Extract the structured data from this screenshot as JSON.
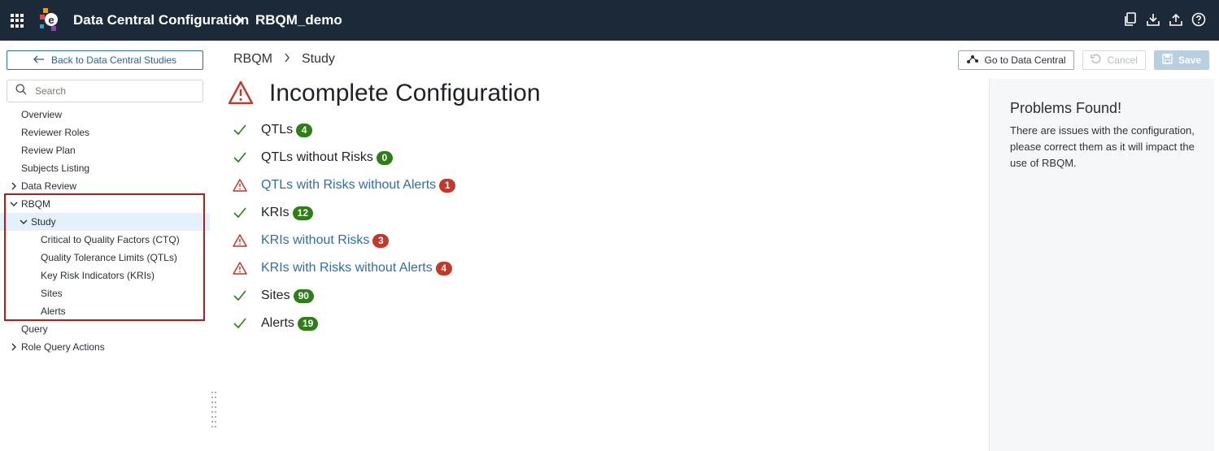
{
  "header": {
    "app_title": "Data Central Configuration",
    "project": "RBQM_demo",
    "colors": {
      "bar": "#1c2939"
    },
    "actions": [
      {
        "icon": "copy-icon"
      },
      {
        "icon": "download-icon"
      },
      {
        "icon": "upload-icon"
      },
      {
        "icon": "help-icon"
      }
    ]
  },
  "sidebar": {
    "back_label": "Back to Data Central Studies",
    "search_placeholder": "Search",
    "items": [
      {
        "label": "Overview",
        "level": 0
      },
      {
        "label": "Reviewer Roles",
        "level": 0
      },
      {
        "label": "Review Plan",
        "level": 0
      },
      {
        "label": "Subjects Listing",
        "level": 0
      },
      {
        "label": "Data Review",
        "level": 0,
        "expandable": true,
        "expanded": false
      },
      {
        "label": "RBQM",
        "level": 0,
        "expandable": true,
        "expanded": true
      },
      {
        "label": "Study",
        "level": 1,
        "expandable": true,
        "expanded": true,
        "selected": true
      },
      {
        "label": "Critical to Quality Factors (CTQ)",
        "level": 2
      },
      {
        "label": "Quality Tolerance Limits (QTLs)",
        "level": 2
      },
      {
        "label": "Key Risk Indicators (KRIs)",
        "level": 2
      },
      {
        "label": "Sites",
        "level": 2
      },
      {
        "label": "Alerts",
        "level": 2
      },
      {
        "label": "Query",
        "level": 0
      },
      {
        "label": "Role Query Actions",
        "level": 0,
        "expandable": true,
        "expanded": false
      }
    ]
  },
  "main": {
    "breadcrumb": [
      "RBQM",
      "Study"
    ],
    "buttons": {
      "go_to": "Go to Data Central",
      "cancel": "Cancel",
      "save": "Save"
    },
    "title": "Incomplete Configuration",
    "checks": [
      {
        "label": "QTLs",
        "count": "4",
        "status": "ok"
      },
      {
        "label": "QTLs without Risks",
        "count": "0",
        "status": "ok"
      },
      {
        "label": "QTLs with Risks without Alerts",
        "count": "1",
        "status": "warning"
      },
      {
        "label": "KRIs",
        "count": "12",
        "status": "ok"
      },
      {
        "label": "KRIs without Risks",
        "count": "3",
        "status": "warning"
      },
      {
        "label": "KRIs with Risks without Alerts",
        "count": "4",
        "status": "warning"
      },
      {
        "label": "Sites",
        "count": "90",
        "status": "ok"
      },
      {
        "label": "Alerts",
        "count": "19",
        "status": "ok"
      }
    ],
    "status_colors": {
      "ok": "#2e7d18",
      "warning": "#c0392b",
      "link": "#2f6ea8"
    }
  },
  "panel": {
    "title": "Problems Found!",
    "text": "There are issues with the configuration, please correct them as it will impact the use of RBQM."
  }
}
